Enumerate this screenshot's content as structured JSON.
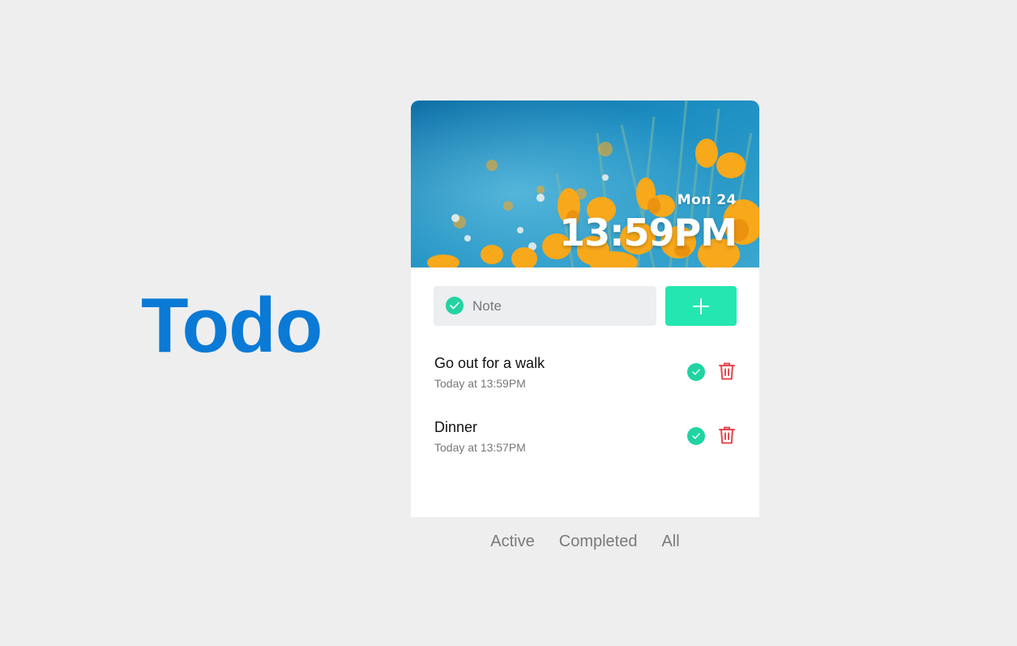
{
  "app": {
    "title": "Todo"
  },
  "header": {
    "date": "Mon 24",
    "time": "13:59PM"
  },
  "new_note": {
    "placeholder": "Note",
    "value": ""
  },
  "todos": [
    {
      "text": "Go out for a walk",
      "time": "Today at 13:59PM"
    },
    {
      "text": "Dinner",
      "time": "Today at 13:57PM"
    }
  ],
  "filters": [
    "Active",
    "Completed",
    "All"
  ],
  "colors": {
    "title": "#0a7ad6",
    "accent": "#24e6b0",
    "check": "#22d3a2",
    "delete": "#e5484d",
    "background": "#eeeeee"
  },
  "icons": {
    "note_check": "check-circle-icon",
    "add": "plus-icon",
    "complete": "check-circle-icon",
    "delete": "trash-icon"
  }
}
